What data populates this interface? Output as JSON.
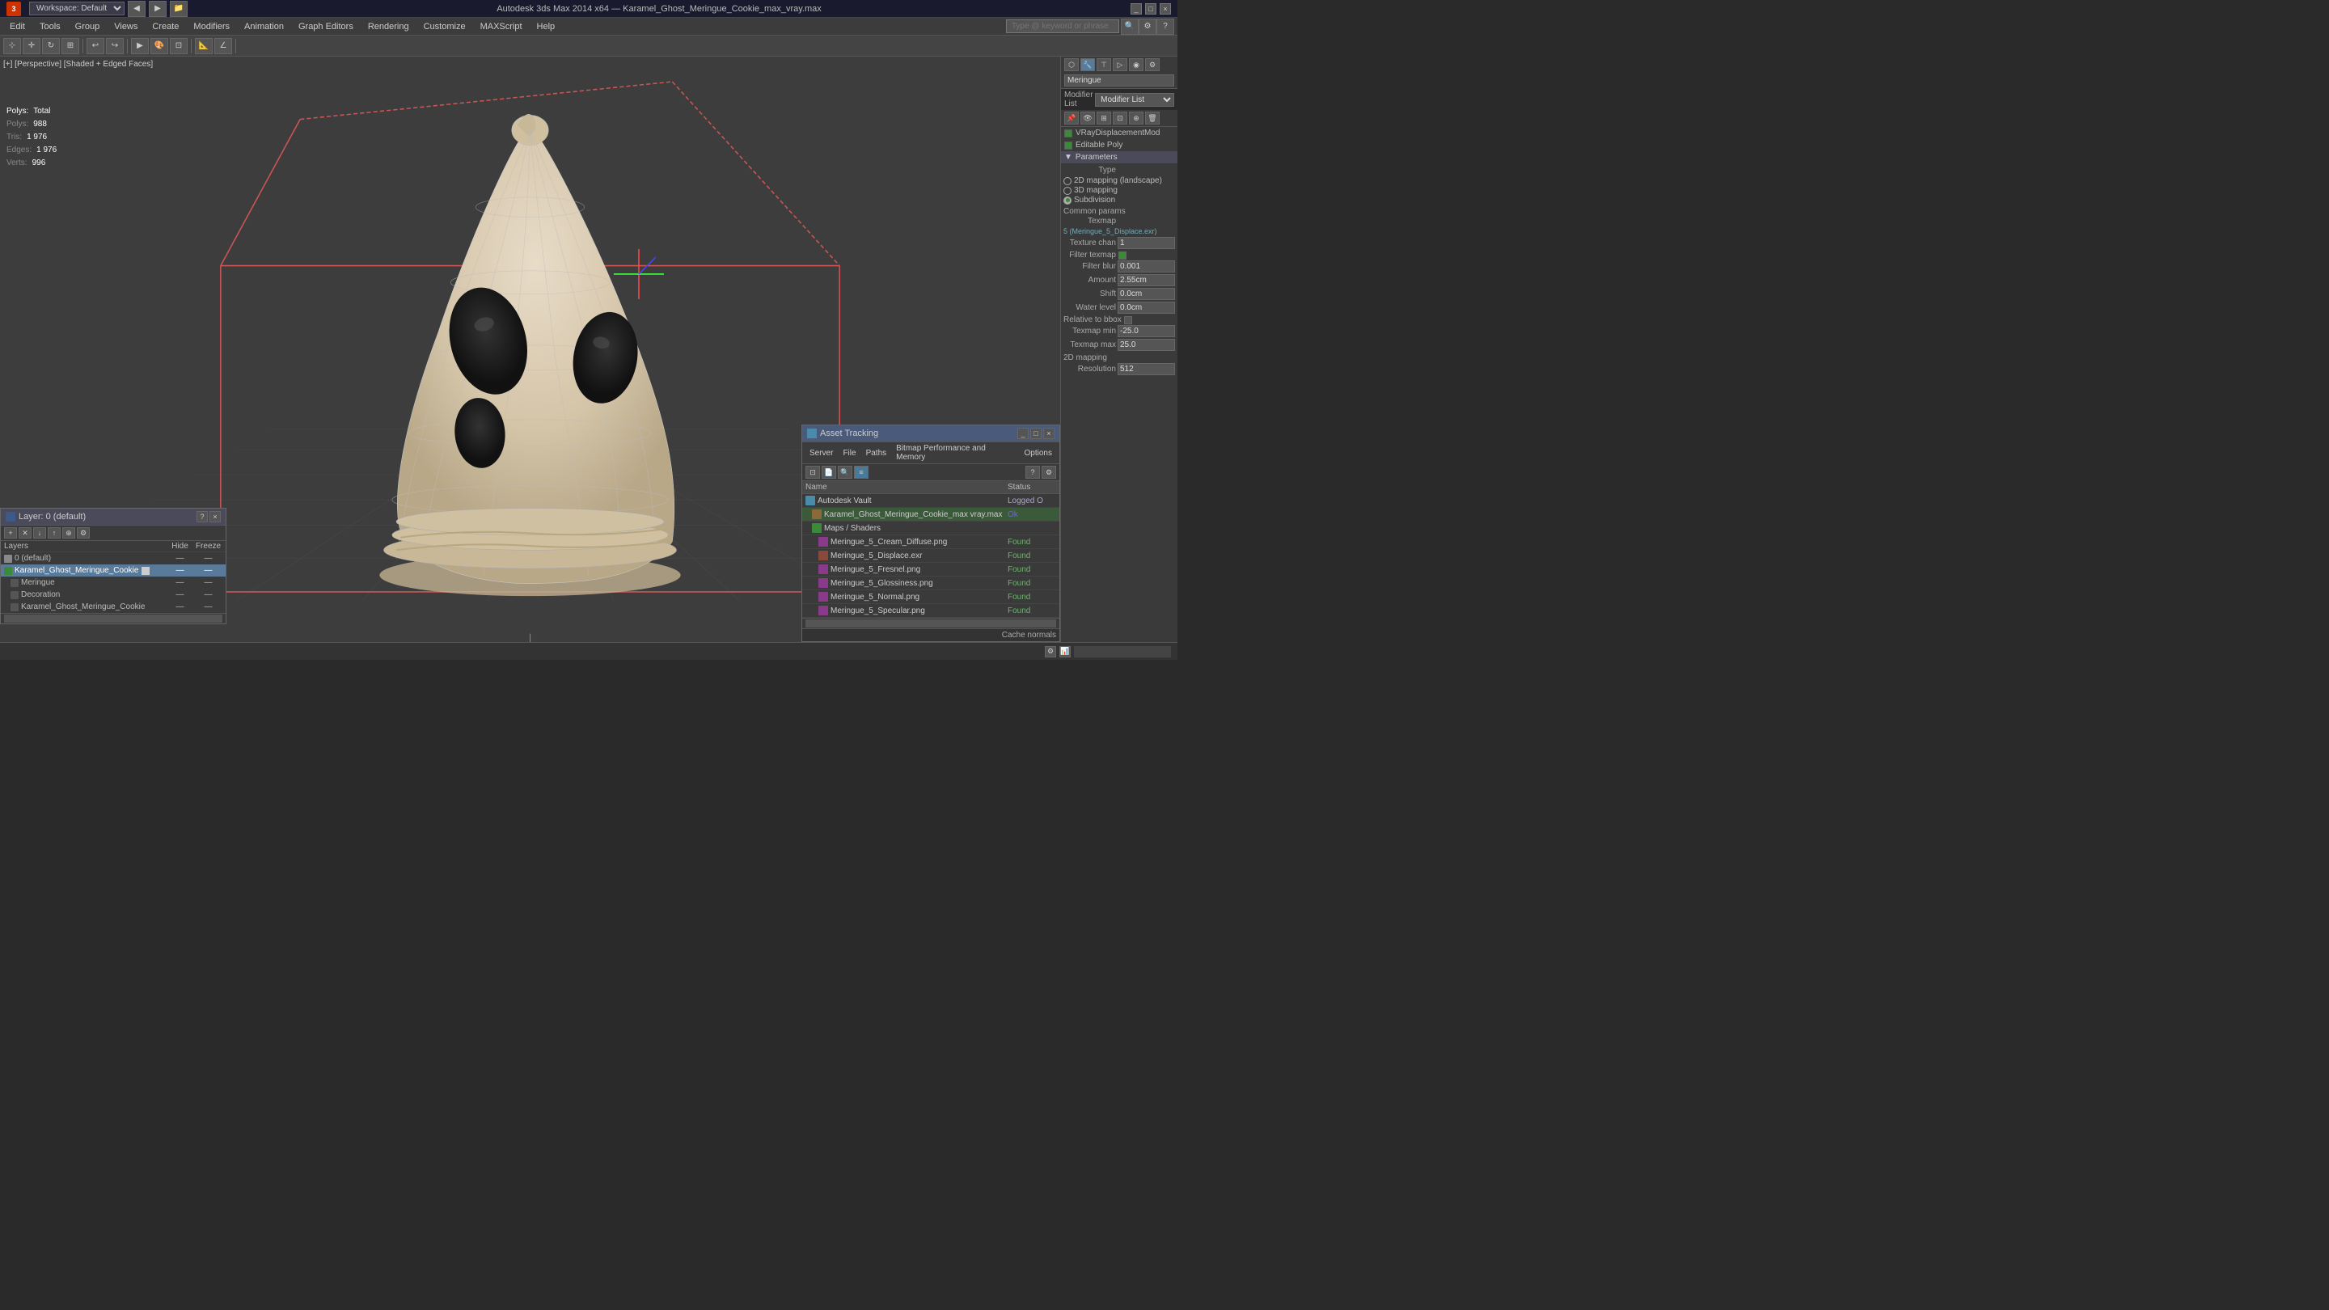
{
  "titlebar": {
    "app": "Autodesk 3ds Max 2014 x64",
    "file": "Karamel_Ghost_Meringue_Cookie_max_vray.max",
    "workspace": "Workspace: Default",
    "controls": [
      "_",
      "□",
      "×"
    ]
  },
  "menubar": {
    "items": [
      "Edit",
      "Tools",
      "Group",
      "Views",
      "Create",
      "Modifiers",
      "Animation",
      "Graph Editors",
      "Rendering",
      "Customize",
      "MAXScript",
      "Help"
    ]
  },
  "search": {
    "placeholder": "Type @ keyword or phrase"
  },
  "viewport": {
    "label": "[+] [Perspective] [Shaded + Edged Faces]",
    "stats": {
      "polys_label": "Polys:",
      "polys_total": "Total",
      "polys_value": "988",
      "tris_label": "Tris:",
      "tris_value": "1 976",
      "edges_label": "Edges:",
      "edges_value": "1 976",
      "verts_label": "Verts:",
      "verts_value": "996"
    }
  },
  "right_panel": {
    "name": "Meringue",
    "modifier_list_label": "Modifier List",
    "modifiers": [
      {
        "name": "VRayDisplacementMod",
        "enabled": true
      },
      {
        "name": "Editable Poly",
        "enabled": true
      }
    ],
    "sections": {
      "parameters": {
        "title": "Parameters",
        "type_label": "Type",
        "types": [
          {
            "label": "2D mapping (landscape)",
            "active": false
          },
          {
            "label": "3D mapping",
            "active": false
          },
          {
            "label": "Subdivision",
            "active": true
          }
        ],
        "common_params_label": "Common params",
        "texmap_label": "Texmap",
        "texmap_value": "5 (Meringue_5_Displace.exr)",
        "texture_chan_label": "Texture chan",
        "texture_chan_value": "1",
        "filter_texmap_label": "Filter texmap",
        "filter_texmap_checked": true,
        "filter_blur_label": "Filter blur",
        "filter_blur_value": "0.001",
        "amount_label": "Amount",
        "amount_value": "2.55cm",
        "shift_label": "Shift",
        "shift_value": "0.0cm",
        "water_level_label": "Water level",
        "water_level_value": "0.0cm",
        "relative_to_bbox_label": "Relative to bbox",
        "relative_to_bbox_checked": false,
        "texmap_min_label": "Texmap min",
        "texmap_min_value": "-25.0",
        "texmap_max_label": "Texmap max",
        "texmap_max_value": "25.0",
        "mapping_2d_label": "2D mapping",
        "resolution_label": "Resolution",
        "resolution_value": "512"
      }
    }
  },
  "layers": {
    "title": "Layer: 0 (default)",
    "header": [
      "Layers",
      "Hide",
      "Freeze"
    ],
    "items": [
      {
        "id": "0-default",
        "name": "0 (default)",
        "indent": 0,
        "selected": false
      },
      {
        "id": "karamel-ghost-cookie",
        "name": "Karamel_Ghost_Meringue_Cookie",
        "indent": 0,
        "selected": true
      },
      {
        "id": "meringue",
        "name": "Meringue",
        "indent": 1,
        "selected": false
      },
      {
        "id": "decoration",
        "name": "Decoration",
        "indent": 1,
        "selected": false
      },
      {
        "id": "karamel-ghost-cookie2",
        "name": "Karamel_Ghost_Meringue_Cookie",
        "indent": 1,
        "selected": false
      }
    ]
  },
  "asset_tracking": {
    "title": "Asset Tracking",
    "menu": [
      "Server",
      "File",
      "Paths",
      "Bitmap Performance and Memory",
      "Options"
    ],
    "columns": [
      "Name",
      "Status"
    ],
    "items": [
      {
        "name": "Autodesk Vault",
        "indent": 0,
        "status": "Logged O",
        "type": "vault"
      },
      {
        "name": "Karamel_Ghost_Meringue_Cookie_max vray.max",
        "indent": 1,
        "status": "Ok",
        "type": "file",
        "selected": true
      },
      {
        "name": "Maps / Shaders",
        "indent": 1,
        "status": "",
        "type": "folder"
      },
      {
        "name": "Meringue_5_Cream_Diffuse.png",
        "indent": 2,
        "status": "Found",
        "type": "image"
      },
      {
        "name": "Meringue_5_Displace.exr",
        "indent": 2,
        "status": "Found",
        "type": "image"
      },
      {
        "name": "Meringue_5_Fresnel.png",
        "indent": 2,
        "status": "Found",
        "type": "image"
      },
      {
        "name": "Meringue_5_Glossiness.png",
        "indent": 2,
        "status": "Found",
        "type": "image"
      },
      {
        "name": "Meringue_5_Normal.png",
        "indent": 2,
        "status": "Found",
        "type": "image"
      },
      {
        "name": "Meringue_5_Specular.png",
        "indent": 2,
        "status": "Found",
        "type": "image"
      }
    ],
    "bottom_label": "Cache normals"
  },
  "statusbar": {
    "text": ""
  }
}
